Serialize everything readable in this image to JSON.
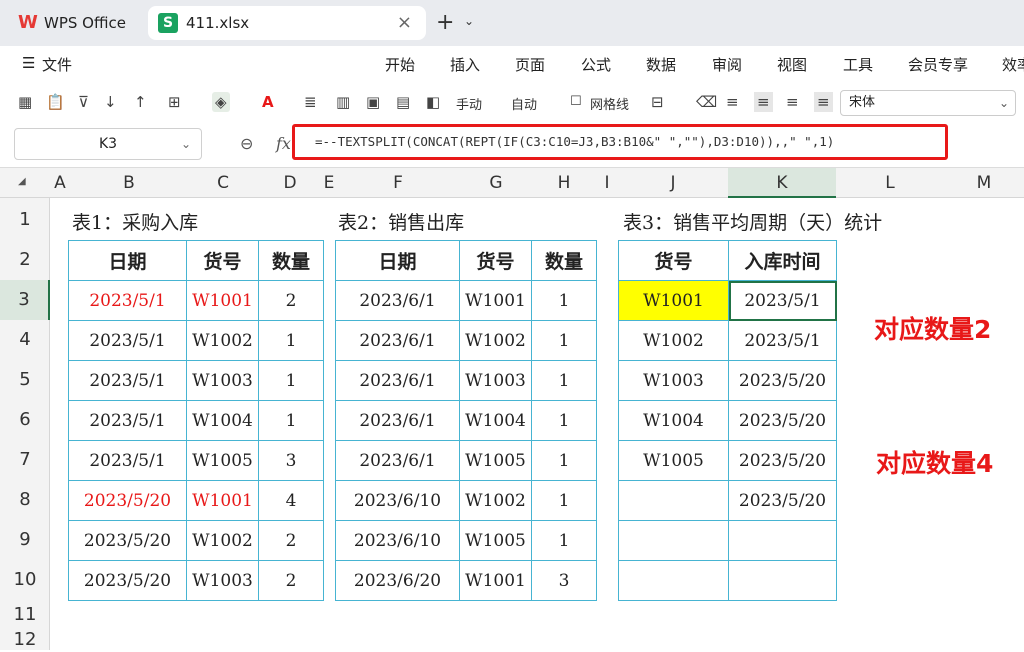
{
  "tabs": {
    "app_title": "WPS Office",
    "file_title": "411.xlsx",
    "close_icon": "×",
    "new_tab": "+"
  },
  "menu": {
    "hamburger": "☰",
    "file": "文件",
    "items": [
      "开始",
      "插入",
      "页面",
      "公式",
      "数据",
      "审阅",
      "视图",
      "工具",
      "会员专享",
      "效率"
    ]
  },
  "toolbar": {
    "manual": "手动",
    "auto": "自动",
    "gridlines": "网格线",
    "font": "宋体"
  },
  "formula_bar": {
    "cell_ref": "K3",
    "formula": "=--TEXTSPLIT(CONCAT(REPT(IF(C3:C10=J3,B3:B10&\" \",\"\"),D3:D10)),,\" \",1)"
  },
  "columns": [
    "A",
    "B",
    "C",
    "D",
    "E",
    "F",
    "G",
    "H",
    "I",
    "J",
    "K",
    "L",
    "M"
  ],
  "rows": [
    "1",
    "2",
    "3",
    "4",
    "5",
    "6",
    "7",
    "8",
    "9",
    "10",
    "11",
    "12"
  ],
  "table1": {
    "caption": "表1：采购入库",
    "headers": [
      "日期",
      "货号",
      "数量"
    ],
    "rows": [
      [
        "2023/5/1",
        "W1001",
        "2"
      ],
      [
        "2023/5/1",
        "W1002",
        "1"
      ],
      [
        "2023/5/1",
        "W1003",
        "1"
      ],
      [
        "2023/5/1",
        "W1004",
        "1"
      ],
      [
        "2023/5/1",
        "W1005",
        "3"
      ],
      [
        "2023/5/20",
        "W1001",
        "4"
      ],
      [
        "2023/5/20",
        "W1002",
        "2"
      ],
      [
        "2023/5/20",
        "W1003",
        "2"
      ]
    ]
  },
  "table2": {
    "caption": "表2：销售出库",
    "headers": [
      "日期",
      "货号",
      "数量"
    ],
    "rows": [
      [
        "2023/6/1",
        "W1001",
        "1"
      ],
      [
        "2023/6/1",
        "W1002",
        "1"
      ],
      [
        "2023/6/1",
        "W1003",
        "1"
      ],
      [
        "2023/6/1",
        "W1004",
        "1"
      ],
      [
        "2023/6/1",
        "W1005",
        "1"
      ],
      [
        "2023/6/10",
        "W1002",
        "1"
      ],
      [
        "2023/6/10",
        "W1005",
        "1"
      ],
      [
        "2023/6/20",
        "W1001",
        "3"
      ]
    ]
  },
  "table3": {
    "caption": "表3：销售平均周期（天）统计",
    "headers": [
      "货号",
      "入库时间"
    ],
    "rows": [
      [
        "W1001",
        "2023/5/1"
      ],
      [
        "W1002",
        "2023/5/1"
      ],
      [
        "W1003",
        "2023/5/20"
      ],
      [
        "W1004",
        "2023/5/20"
      ],
      [
        "W1005",
        "2023/5/20"
      ],
      [
        "",
        "2023/5/20"
      ],
      [
        "",
        ""
      ],
      [
        "",
        ""
      ]
    ]
  },
  "annotations": {
    "note1": "对应数量2",
    "note2": "对应数量4"
  },
  "colors": {
    "highlight_red": "#e81818",
    "highlight_yellow": "#ffff00",
    "table_border": "#46b4d2",
    "selection": "#217346"
  }
}
